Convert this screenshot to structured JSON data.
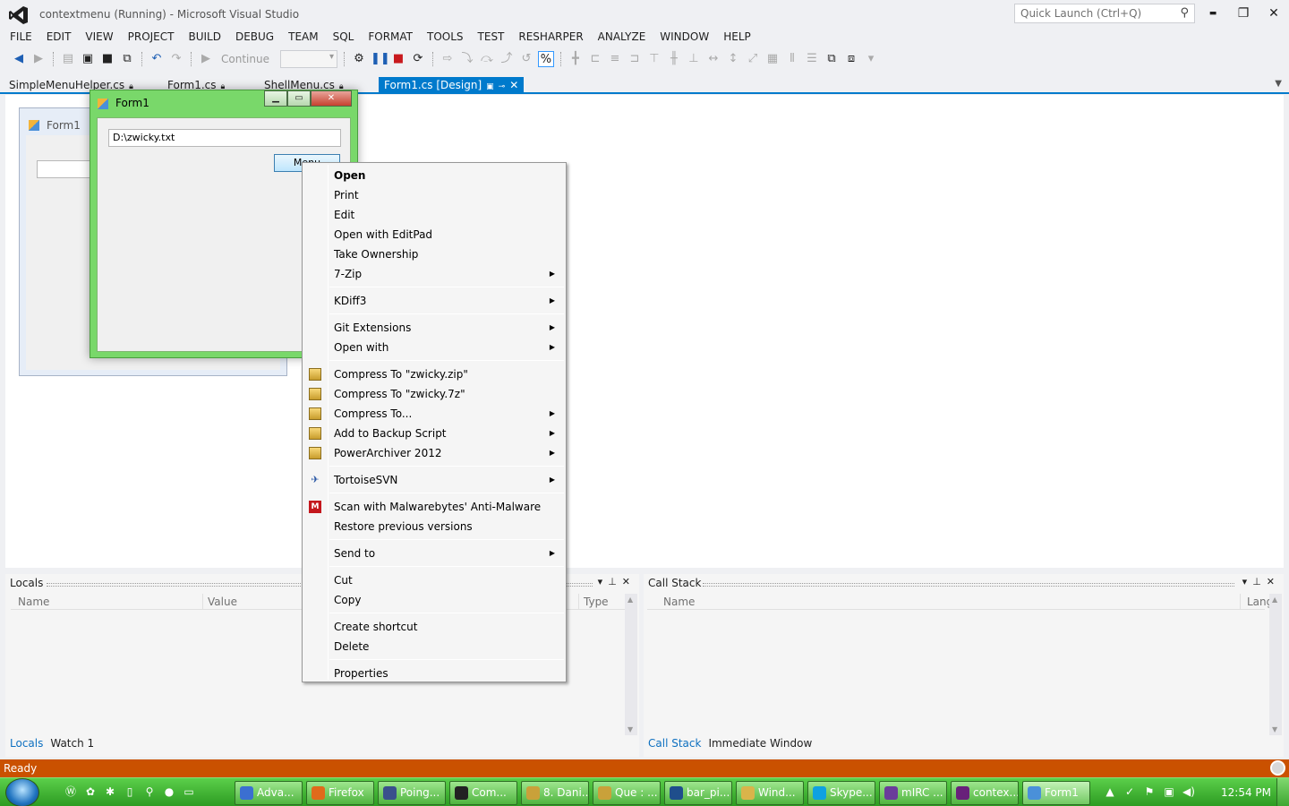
{
  "window": {
    "title": "contextmenu (Running) - Microsoft Visual Studio",
    "quick_launch_placeholder": "Quick Launch (Ctrl+Q)",
    "buttons": {
      "minimize": "▬",
      "restore": "❐",
      "close": "✕"
    }
  },
  "menu": [
    "FILE",
    "EDIT",
    "VIEW",
    "PROJECT",
    "BUILD",
    "DEBUG",
    "TEAM",
    "SQL",
    "FORMAT",
    "TOOLS",
    "TEST",
    "RESHARPER",
    "ANALYZE",
    "WINDOW",
    "HELP"
  ],
  "toolbar": {
    "continue_label": "Continue"
  },
  "doc_tabs": [
    {
      "label": "SimpleMenuHelper.cs"
    },
    {
      "label": "Form1.cs"
    },
    {
      "label": "ShellMenu.cs"
    },
    {
      "label": "Form1.cs [Design]"
    }
  ],
  "designer": {
    "form_title": "Form1"
  },
  "running_form": {
    "title": "Form1",
    "textbox_value": "D:\\zwicky.txt",
    "button_label": "Menu"
  },
  "context_menu": {
    "groups": [
      [
        {
          "label": "Open",
          "bold": true
        },
        {
          "label": "Print"
        },
        {
          "label": "Edit"
        },
        {
          "label": "Open with EditPad"
        },
        {
          "label": "Take Ownership"
        },
        {
          "label": "7-Zip",
          "submenu": true
        }
      ],
      [
        {
          "label": "KDiff3",
          "submenu": true
        }
      ],
      [
        {
          "label": "Git Extensions",
          "submenu": true
        },
        {
          "label": "Open with",
          "submenu": true
        }
      ],
      [
        {
          "label": "Compress To \"zwicky.zip\"",
          "icon": "archive-icon"
        },
        {
          "label": "Compress To \"zwicky.7z\"",
          "icon": "archive-icon"
        },
        {
          "label": "Compress To...",
          "icon": "archive-icon",
          "submenu": true
        },
        {
          "label": "Add to Backup Script",
          "icon": "archive-icon",
          "submenu": true
        },
        {
          "label": "PowerArchiver 2012",
          "icon": "archive-icon",
          "submenu": true
        }
      ],
      [
        {
          "label": "TortoiseSVN",
          "icon": "tortoise-icon",
          "submenu": true
        }
      ],
      [
        {
          "label": "Scan with Malwarebytes' Anti-Malware",
          "icon": "malwarebytes-icon"
        },
        {
          "label": "Restore previous versions"
        }
      ],
      [
        {
          "label": "Send to",
          "submenu": true
        }
      ],
      [
        {
          "label": "Cut"
        },
        {
          "label": "Copy"
        }
      ],
      [
        {
          "label": "Create shortcut"
        },
        {
          "label": "Delete"
        }
      ],
      [
        {
          "label": "Properties"
        }
      ]
    ]
  },
  "locals_panel": {
    "title": "Locals",
    "columns": [
      "Name",
      "Value",
      "Type"
    ],
    "tabs": [
      "Locals",
      "Watch 1"
    ]
  },
  "callstack_panel": {
    "title": "Call Stack",
    "columns": [
      "Name",
      "Lang"
    ],
    "tabs": [
      "Call Stack",
      "Immediate Window"
    ]
  },
  "status": {
    "text": "Ready"
  },
  "taskbar": {
    "buttons": [
      {
        "label": "Adva...",
        "color": "#3b6fd1",
        "icon": "chrome-icon"
      },
      {
        "label": "Firefox",
        "color": "#e06a1b",
        "icon": "firefox-icon"
      },
      {
        "label": "Poing...",
        "color": "#3a4f8c",
        "icon": "pidgin-icon"
      },
      {
        "label": "Com...",
        "color": "#222222",
        "icon": "console-icon"
      },
      {
        "label": "8. Dani...",
        "color": "#c9a13a",
        "icon": "notepad-icon"
      },
      {
        "label": "Que : ...",
        "color": "#c9a13a",
        "icon": "notepad-icon"
      },
      {
        "label": "bar_pi...",
        "color": "#1f4e8c",
        "icon": "photoshop-icon"
      },
      {
        "label": "Wind...",
        "color": "#d9b44a",
        "icon": "folder-icon"
      },
      {
        "label": "Skype...",
        "color": "#0fa1e0",
        "icon": "skype-icon"
      },
      {
        "label": "mIRC ...",
        "color": "#6a3c9a",
        "icon": "mirc-icon"
      },
      {
        "label": "contex...",
        "color": "#68217a",
        "icon": "visual-studio-icon"
      },
      {
        "label": "Form1",
        "color": "#4a90d9",
        "icon": "form-icon",
        "active": true
      }
    ],
    "clock": "12:54 PM"
  }
}
